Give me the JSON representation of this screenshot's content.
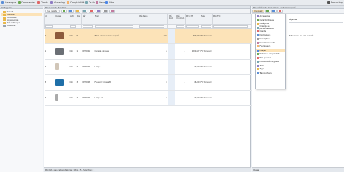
{
  "topbar": {
    "items": [
      {
        "label": "Catalogue",
        "color": "#5b8ed6"
      },
      {
        "label": "Commandes",
        "color": "#6aa84f"
      },
      {
        "label": "Clients",
        "color": "#e06666"
      },
      {
        "label": "Marketing",
        "color": "#8e7cc3"
      },
      {
        "label": "Comptabilité",
        "color": "#f6b26b"
      },
      {
        "label": "Outils",
        "color": "#76a5af"
      },
      {
        "label": "Liens",
        "color": "#c27ba0"
      },
      {
        "label": "Aide",
        "color": "#4a86e8"
      }
    ],
    "right_label": "Prestashop"
  },
  "sidebar": {
    "title": "Catégories",
    "nodes": [
      {
        "label": "Accueil",
        "level": 0
      },
      {
        "label": "Meubles",
        "level": 1
      },
      {
        "label": "corbeilles",
        "level": 1
      },
      {
        "label": "Accessoires",
        "level": 1
      },
      {
        "label": "Pré-catalogue",
        "level": 1
      },
      {
        "label": "Corbeille",
        "level": 1
      }
    ]
  },
  "center": {
    "title": "Produits de Meubles",
    "toolbar_label": "Vue rapide",
    "columns": [
      "id",
      "Image",
      "Actif",
      "Pos",
      "Réf",
      "Nom",
      "Qté dispo",
      "Qté stock",
      "Qté minimum",
      "Prix HT",
      "Taxe",
      "Prix TTC"
    ],
    "rows": [
      {
        "id": "6",
        "image_color": "#8c5a3c",
        "active": "Oui",
        "pos": "0",
        "ref": "",
        "name": "Table basse en bois recyclé",
        "qty": "300",
        "min": "1",
        "price_ht": "399,00",
        "tax": "FR Standard",
        "selected": true
      },
      {
        "id": "1",
        "image_color": "#6b6f75",
        "active": "Oui",
        "pos": "1",
        "ref": "REF0001",
        "name": "Canapé vintage",
        "qty": "6",
        "min": "1",
        "price_ht": "1290,17",
        "tax": "FR Standard",
        "selected": false
      },
      {
        "id": "2",
        "image_color": "#d1c6b8",
        "active": "Oui",
        "pos": "2",
        "ref": "REF0002",
        "name": "Lampe",
        "qty": "1",
        "min": "1",
        "price_ht": "29,00",
        "tax": "FR Standard",
        "selected": false
      },
      {
        "id": "3",
        "image_color": "#1f6fa8",
        "active": "Oui",
        "pos": "3",
        "ref": "REF0003",
        "name": "Fauteuil vintage B",
        "qty": "3",
        "min": "1",
        "price_ht": "46,00",
        "tax": "FR Standard",
        "selected": false
      },
      {
        "id": "4",
        "image_color": "#aaaaaa",
        "active": "Oui",
        "pos": "4",
        "ref": "REF0004",
        "name": "Lampe 2",
        "qty": "3",
        "min": "1",
        "price_ht": "29,00",
        "tax": "FR Standard",
        "selected": false
      }
    ],
    "status": "Produits dans cette catégorie : Filtrés : 5 - Sélection : 1"
  },
  "right": {
    "title": "Propriétés de Table basse en bois recyclé",
    "tab_label": "Images",
    "legend_label": "Légende",
    "row_value": "Table basse en bois recyclé",
    "menu": [
      {
        "label": "Accessoires",
        "color": "#8e7cc3"
      },
      {
        "label": "Caractéristiques",
        "color": "#6aa84f"
      },
      {
        "label": "Catégories",
        "color": "#e9b84a"
      },
      {
        "label": "Champs de personnalisation",
        "color": "#76a5af"
      },
      {
        "label": "Clients",
        "color": "#e06666"
      },
      {
        "label": "Déclinaisons",
        "color": "#5b8ed6"
      },
      {
        "label": "Description",
        "color": "#999999"
      },
      {
        "label": "Documents joints",
        "color": "#c27ba0"
      },
      {
        "label": "Fournisseurs",
        "color": "#f6b26b"
      },
      {
        "label": "Images",
        "color": "#4a86e8"
      },
      {
        "label": "Historique des produits",
        "color": "#6aa84f"
      },
      {
        "label": "Prix spéciaux",
        "color": "#e06666"
      },
      {
        "label": "Produit téléchargeable",
        "color": "#76a5af"
      },
      {
        "label": "SEO",
        "color": "#8e7cc3"
      },
      {
        "label": "Tags",
        "color": "#e9b84a"
      },
      {
        "label": "Transporteurs",
        "color": "#5b8ed6"
      }
    ],
    "status": "Image"
  }
}
